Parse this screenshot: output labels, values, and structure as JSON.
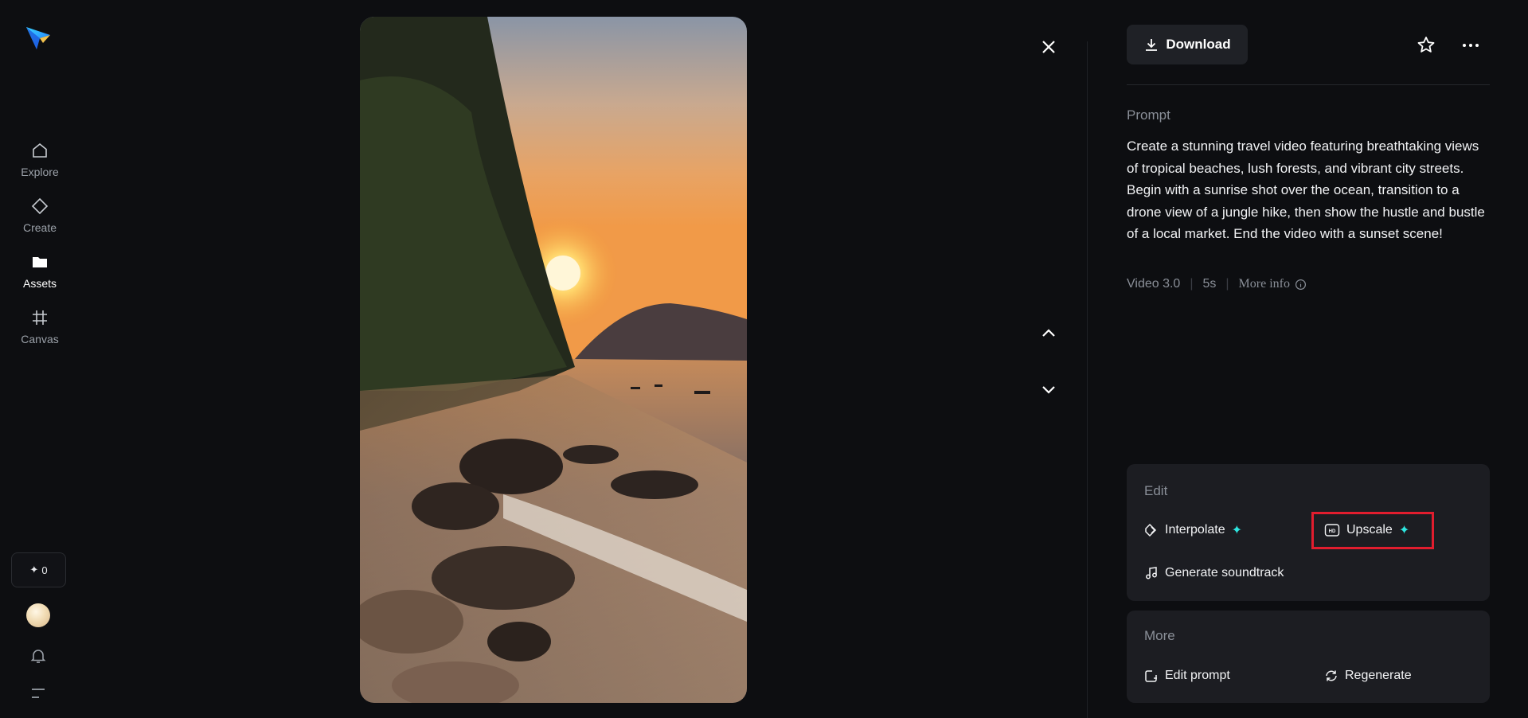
{
  "sidebar": {
    "items": [
      {
        "label": "Explore",
        "icon": "home-icon"
      },
      {
        "label": "Create",
        "icon": "diamond-icon"
      },
      {
        "label": "Assets",
        "icon": "folder-icon"
      },
      {
        "label": "Canvas",
        "icon": "canvas-grid-icon"
      }
    ],
    "active": "Assets",
    "credits": "0"
  },
  "toolbar": {
    "download_label": "Download"
  },
  "prompt": {
    "label": "Prompt",
    "text": "Create a stunning travel video featuring breathtaking views of tropical beaches, lush forests, and vibrant city streets. Begin with a sunrise shot over the ocean, transition to a drone view of a jungle hike, then show the hustle and bustle of a local market. End the video with a sunset scene!"
  },
  "meta": {
    "model": "Video 3.0",
    "duration": "5s",
    "more_info": "More info"
  },
  "edit": {
    "title": "Edit",
    "interpolate": "Interpolate",
    "upscale": "Upscale",
    "soundtrack": "Generate soundtrack"
  },
  "more": {
    "title": "More",
    "edit_prompt": "Edit prompt",
    "regenerate": "Regenerate"
  },
  "colors": {
    "background": "#0d0e11",
    "card": "#1c1d22",
    "accent_sparkle": "#2ee6e0",
    "highlight_box": "#e11d2e"
  }
}
